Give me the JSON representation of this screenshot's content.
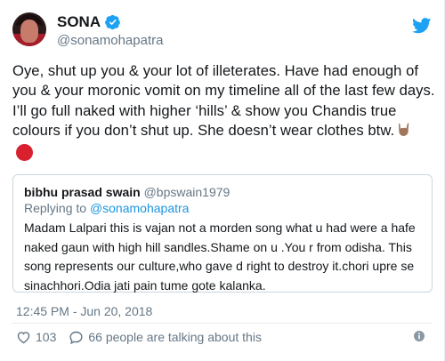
{
  "user": {
    "display_name": "SONA",
    "handle": "@sonamohapatra",
    "verified": true
  },
  "tweet": {
    "text": "Oye, shut up you & your lot of illeterates. Have had enough of you & your moronic vomit on my timeline all of the last few days. I’ll go full naked with higher ‘hills’ & show you Chandis true colours if you don’t shut up. She doesn’t wear clothes btw.",
    "emojis": [
      "sign-of-the-horns-medium-dark-skin-tone",
      "red-circle"
    ]
  },
  "quoted_tweet": {
    "name": "bibhu prasad swain",
    "handle": "@bpswain1979",
    "replying_prefix": "Replying to ",
    "replying_to": "@sonamohapatra",
    "text": "Madam Lalpari this is vajan not a morden song what u had were a hafe naked gaun with high hill sandles.Shame on u .You r from odisha. This song represents our culture,who gave d right to destroy it.chori upre se sinachhori.Odia jati pain tume gote kalanka."
  },
  "meta": {
    "timestamp": "12:45 PM - Jun 20, 2018",
    "likes": "103",
    "talking": "66 people are talking about this"
  },
  "colors": {
    "twitter_blue": "#1da1f2",
    "link_blue": "#1b95e0",
    "muted_gray": "#657786",
    "border": "#ccd6dd"
  }
}
